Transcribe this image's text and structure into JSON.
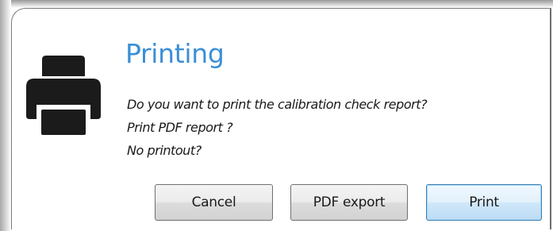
{
  "dialog": {
    "title": "Printing",
    "icon": "printer-icon",
    "message_lines": [
      "Do you want to print the calibration check report?",
      "Print PDF report ?",
      "No printout?"
    ],
    "title_color": "#3b8fd6"
  },
  "buttons": {
    "cancel_label": "Cancel",
    "pdf_export_label": "PDF export",
    "print_label": "Print"
  }
}
